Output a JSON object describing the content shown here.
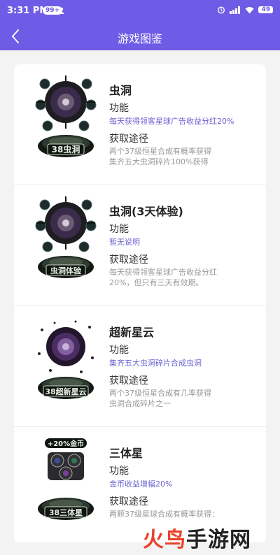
{
  "status": {
    "time": "3:31 PM",
    "badge": "99+",
    "battery": "49"
  },
  "nav": {
    "title": "游戏图鉴"
  },
  "items": [
    {
      "name": "虫洞",
      "func_label": "功能",
      "func": "每天获得领客星球广告收益分红20%",
      "get_label": "获取途径",
      "get": "两个37级恒星合成有概率获得\n集齐五大虫洞碎片100%获得",
      "badge": "38虫洞"
    },
    {
      "name": "虫洞(3天体验)",
      "func_label": "功能",
      "func": "暂无说明",
      "get_label": "获取途径",
      "get": "每天获得领客星球广告收益分红\n20%，但只有三天有效期。",
      "badge": "虫洞体验"
    },
    {
      "name": "超新星云",
      "func_label": "功能",
      "func": "集齐五大虫洞碎片合成虫洞",
      "get_label": "获取途径",
      "get": "两个37级恒星合成有几率获得\n虫洞合成碎片之一",
      "badge": "38超新星云"
    },
    {
      "name": "三体星",
      "func_label": "功能",
      "func": "金币收益增幅20%",
      "get_label": "获取途径",
      "get": "两颗37级星球合成有概率获得：",
      "badge": "38三体星",
      "top_badge": "+20%金币"
    }
  ],
  "watermark": {
    "part1": "火鸟",
    "part2": "手游网"
  }
}
